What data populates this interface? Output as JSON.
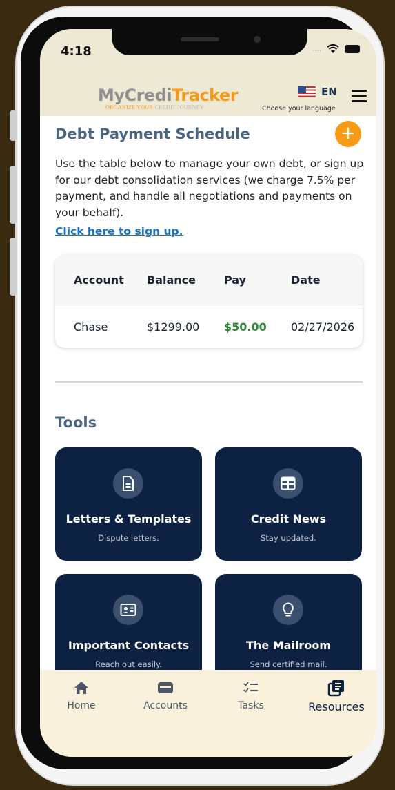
{
  "status": {
    "time": "4:18"
  },
  "header": {
    "logo_part1": "MyCredi",
    "logo_part2": "Tracker",
    "tagline_part1": "ORGANIZE YOUR",
    "tagline_part2": " CREDIT JOURNEY",
    "language": "EN",
    "language_hint": "Choose your language"
  },
  "debt": {
    "title": "Debt Payment Schedule",
    "add_icon_label": "+",
    "intro": "Use the table below to manage your own debt, or sign up for our debt consolidation services (we charge 7.5% per payment, and handle all negotiations and payments on your behalf).",
    "signup_link": "Click here to sign up.",
    "columns": [
      "Account",
      "Balance",
      "Pay",
      "Date"
    ],
    "rows": [
      {
        "account": "Chase",
        "balance": "$1299.00",
        "pay": "$50.00",
        "date": "02/27/2026"
      }
    ]
  },
  "tools": {
    "title": "Tools",
    "cards": [
      {
        "title": "Letters & Templates",
        "subtitle": "Dispute letters.",
        "icon": "document-icon"
      },
      {
        "title": "Credit News",
        "subtitle": "Stay updated.",
        "icon": "news-icon"
      },
      {
        "title": "Important Contacts",
        "subtitle": "Reach out easily.",
        "icon": "contact-card-icon"
      },
      {
        "title": "The Mailroom",
        "subtitle": "Send certified mail.",
        "icon": "lightbulb-icon"
      }
    ]
  },
  "nav": {
    "items": [
      {
        "label": "Home",
        "icon": "home-icon"
      },
      {
        "label": "Accounts",
        "icon": "wallet-icon"
      },
      {
        "label": "Tasks",
        "icon": "checklist-icon"
      },
      {
        "label": "Resources",
        "icon": "resources-icon",
        "active": true
      }
    ]
  },
  "colors": {
    "accent": "#f79a15",
    "navy": "#0d2142",
    "heading": "#4a6580",
    "pay_green": "#2e8b3a"
  }
}
